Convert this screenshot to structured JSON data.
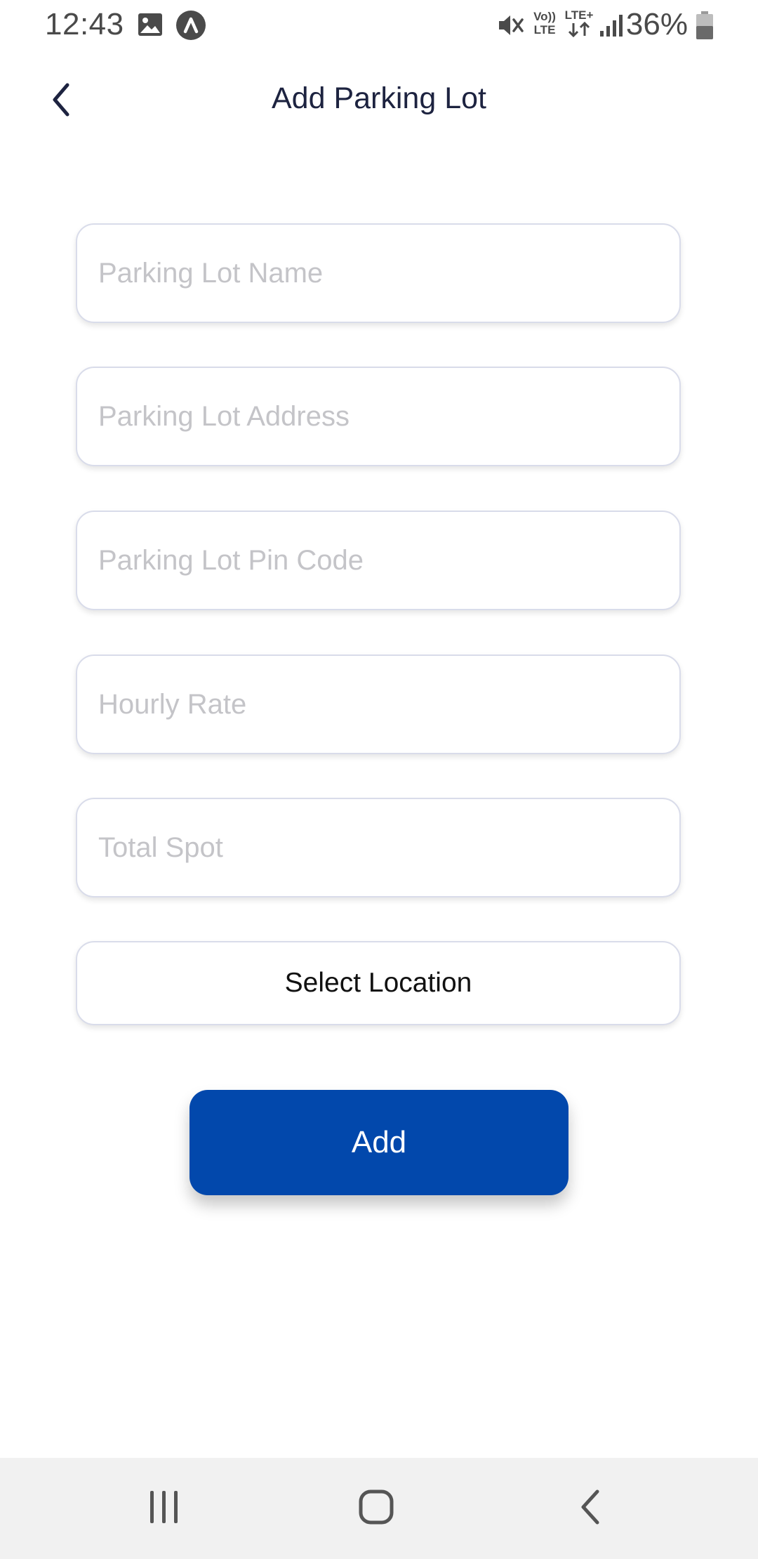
{
  "status_bar": {
    "time": "12:43",
    "battery": "36%",
    "icons": [
      "image-icon",
      "app-a-icon",
      "mute-icon",
      "volte-icon",
      "lte-plus-icon",
      "signal-icon",
      "battery-icon"
    ],
    "volte_label_top": "Vo))",
    "volte_label_bottom": "LTE",
    "lte_label": "LTE+"
  },
  "header": {
    "title": "Add Parking Lot",
    "back_icon": "chevron-left-icon"
  },
  "form": {
    "name_placeholder": "Parking Lot Name",
    "address_placeholder": "Parking Lot Address",
    "pincode_placeholder": "Parking Lot Pin Code",
    "hourly_rate_placeholder": "Hourly Rate",
    "total_spot_placeholder": "Total Spot",
    "select_location_label": "Select Location",
    "add_label": "Add"
  },
  "colors": {
    "primary": "#0248ac",
    "title_text": "#1d2340",
    "placeholder": "#c4c4c8",
    "field_border": "#d9dcea",
    "nav_bar_bg": "#f1f1f1"
  },
  "nav_bar": {
    "icons": [
      "recent-apps-icon",
      "home-icon",
      "back-icon"
    ]
  }
}
